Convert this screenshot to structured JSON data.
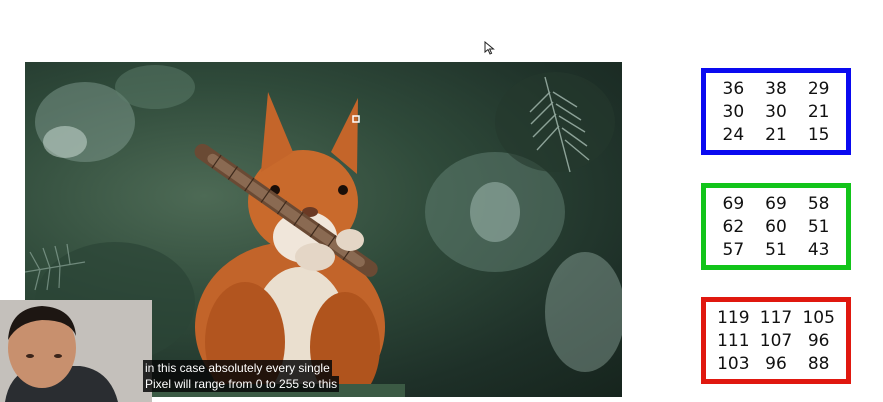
{
  "slide": {
    "matrices": [
      {
        "channel_color": "#0a0af0",
        "values": [
          "36",
          "38",
          "29",
          "30",
          "30",
          "21",
          "24",
          "21",
          "15"
        ]
      },
      {
        "channel_color": "#12c41a",
        "values": [
          "69",
          "69",
          "58",
          "62",
          "60",
          "51",
          "57",
          "51",
          "43"
        ]
      },
      {
        "channel_color": "#e0180f",
        "values": [
          "119",
          "117",
          "105",
          "111",
          "107",
          "96",
          "103",
          "96",
          "88"
        ]
      }
    ]
  },
  "captions": {
    "line1": "in this case absolutely every single",
    "line2": "Pixel will range from 0 to 255 so this"
  }
}
